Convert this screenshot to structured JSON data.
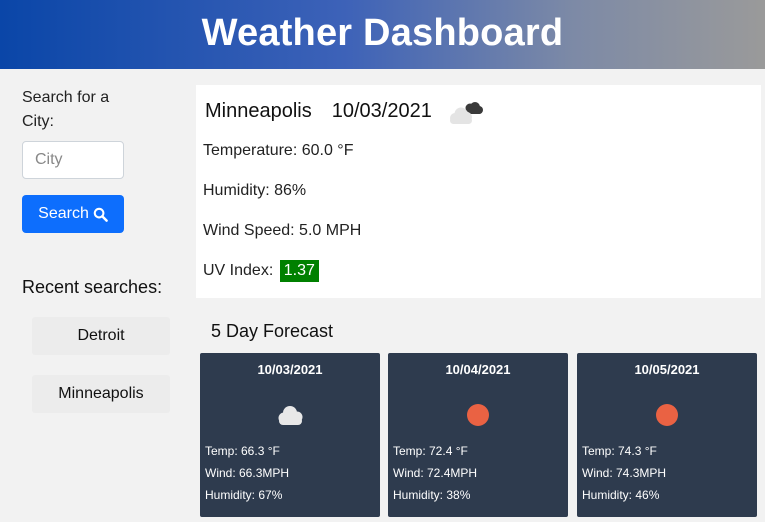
{
  "header": {
    "title": "Weather Dashboard"
  },
  "sidebar": {
    "search_label": "Search for a City:",
    "city_placeholder": "City",
    "search_button": "Search",
    "recent_title": "Recent searches:",
    "recent": [
      "Detroit",
      "Minneapolis"
    ]
  },
  "current": {
    "city": "Minneapolis",
    "date": "10/03/2021",
    "icon": "clouds-icon",
    "temperature": "Temperature: 60.0 °F",
    "humidity": "Humidity: 86%",
    "wind": "Wind Speed: 5.0 MPH",
    "uv_label": "UV Index:",
    "uv_value": "1.37",
    "uv_color": "#008000"
  },
  "forecast": {
    "title": "5 Day Forecast",
    "days": [
      {
        "date": "10/03/2021",
        "icon": "cloud-icon",
        "temp": "Temp: 66.3 °F",
        "wind": "Wind: 66.3MPH",
        "humidity": "Humidity: 67%"
      },
      {
        "date": "10/04/2021",
        "icon": "sun-icon",
        "temp": "Temp: 72.4 °F",
        "wind": "Wind: 72.4MPH",
        "humidity": "Humidity: 38%"
      },
      {
        "date": "10/05/2021",
        "icon": "sun-icon",
        "temp": "Temp: 74.3 °F",
        "wind": "Wind: 74.3MPH",
        "humidity": "Humidity: 46%"
      }
    ]
  },
  "colors": {
    "accent": "#0d6efd",
    "card_bg": "#2e3b4e",
    "sun": "#ea6243"
  }
}
